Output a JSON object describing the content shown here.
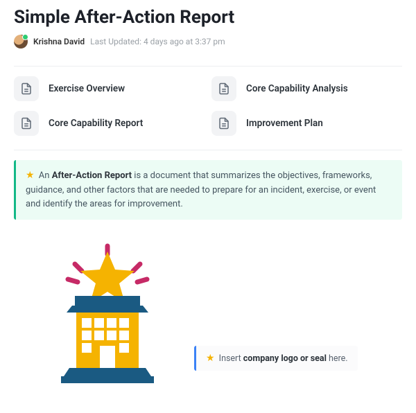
{
  "title": "Simple After-Action Report",
  "author": "Krishna David",
  "updated": "Last Updated: 4 days ago at 3:37 pm",
  "toc": [
    {
      "label": "Exercise Overview"
    },
    {
      "label": "Core Capability Analysis"
    },
    {
      "label": "Core Capability Report"
    },
    {
      "label": "Improvement Plan"
    }
  ],
  "callout": {
    "prefix": "An ",
    "bold": "After-Action Report",
    "rest": " is a document that summarizes the objectives, frameworks, guidance, and other factors that are needed to prepare for an incident, exercise, or event and identify the areas for improvement."
  },
  "insert": {
    "prefix": "Insert ",
    "bold": "company logo or seal",
    "rest": " here."
  }
}
